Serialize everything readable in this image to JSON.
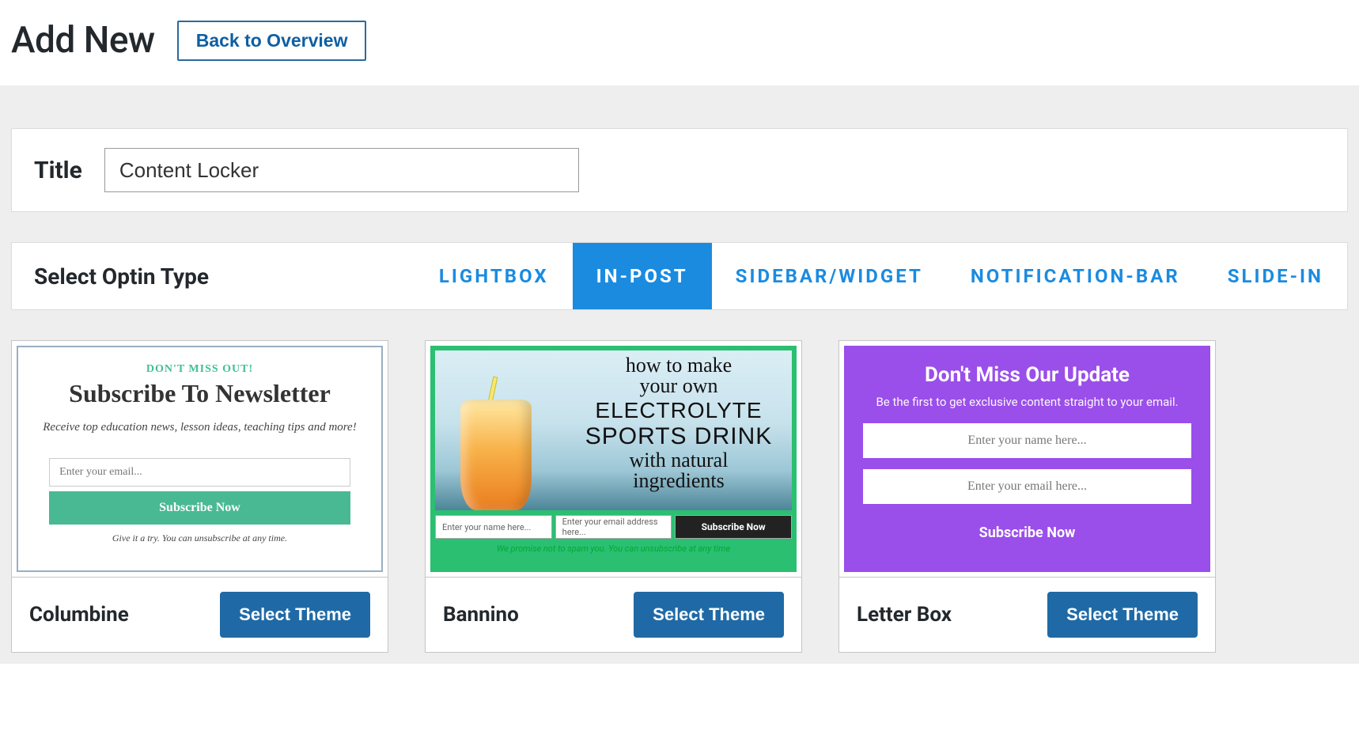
{
  "header": {
    "title": "Add New",
    "back_label": "Back to Overview"
  },
  "title_panel": {
    "label": "Title",
    "value": "Content Locker"
  },
  "type_panel": {
    "label": "Select Optin Type",
    "tabs": [
      {
        "label": "LIGHTBOX",
        "active": false
      },
      {
        "label": "IN-POST",
        "active": true
      },
      {
        "label": "SIDEBAR/WIDGET",
        "active": false
      },
      {
        "label": "NOTIFICATION-BAR",
        "active": false
      },
      {
        "label": "SLIDE-IN",
        "active": false
      }
    ]
  },
  "themes": [
    {
      "name": "Columbine",
      "select_label": "Select Theme",
      "preview": {
        "eyebrow": "DON'T MISS OUT!",
        "title": "Subscribe To Newsletter",
        "subtitle": "Receive top education news, lesson ideas, teaching tips and more!",
        "email_placeholder": "Enter your email...",
        "button": "Subscribe Now",
        "footnote": "Give it a try. You can unsubscribe at any time."
      }
    },
    {
      "name": "Bannino",
      "select_label": "Select Theme",
      "preview": {
        "script_line1": "how to make",
        "script_line2": "your own",
        "block_line1": "ELECTROLYTE",
        "block_line2": "SPORTS DRINK",
        "script_line3": "with natural",
        "script_line4": "ingredients",
        "name_placeholder": "Enter your name here...",
        "email_placeholder": "Enter your email address here...",
        "button": "Subscribe Now",
        "footnote": "We promise not to spam you. You can unsubscribe at any time"
      }
    },
    {
      "name": "Letter Box",
      "select_label": "Select Theme",
      "preview": {
        "title": "Don't Miss Our Update",
        "subtitle": "Be the first to get exclusive content straight to your email.",
        "name_placeholder": "Enter your name here...",
        "email_placeholder": "Enter your email here...",
        "button": "Subscribe Now"
      }
    }
  ]
}
